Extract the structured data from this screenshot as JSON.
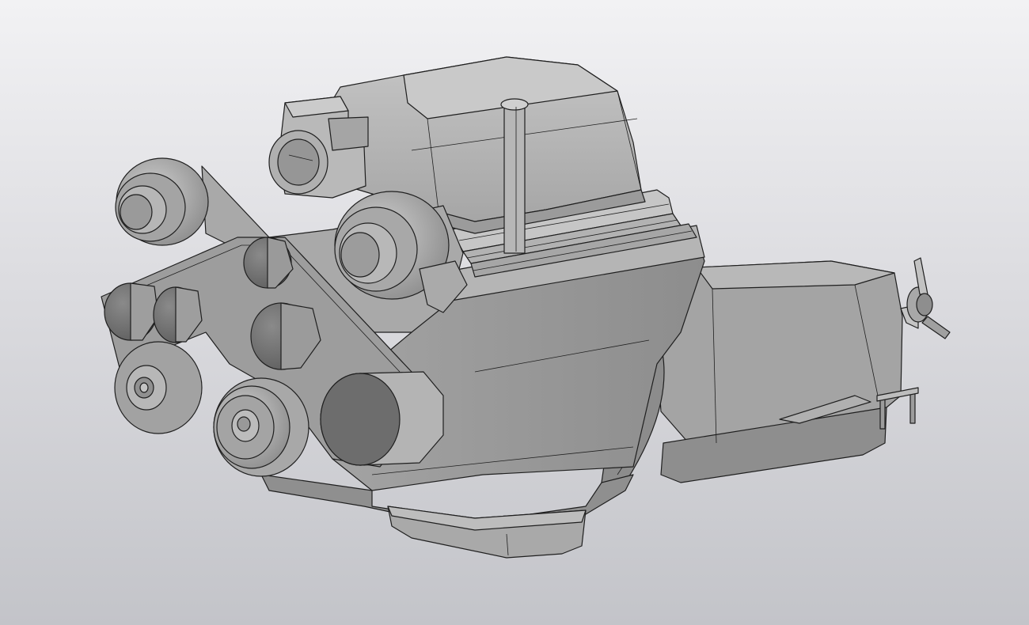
{
  "viewport": {
    "background_top": "#f2f2f4",
    "background_bottom": "#c3c4c9",
    "model_shade_light": "#b3b3b3",
    "model_shade_mid": "#9a9a9a",
    "model_shade_dark": "#6f6f6f",
    "edge_color": "#1f1f1f"
  },
  "model": {
    "icon": "engine-assembly-3d-model",
    "parts": [
      "air-intake-housing",
      "intake-pipe",
      "throttle-body",
      "oil-dipstick",
      "valve-cover-ribs",
      "cylinder-block",
      "serpentine-belt",
      "upper-left-idler-pulley",
      "upper-right-idler-pulley",
      "accessory-pulleys",
      "crankshaft-pulley",
      "oil-pan",
      "gearbox-housing",
      "wing-nut",
      "mounting-pins"
    ]
  }
}
